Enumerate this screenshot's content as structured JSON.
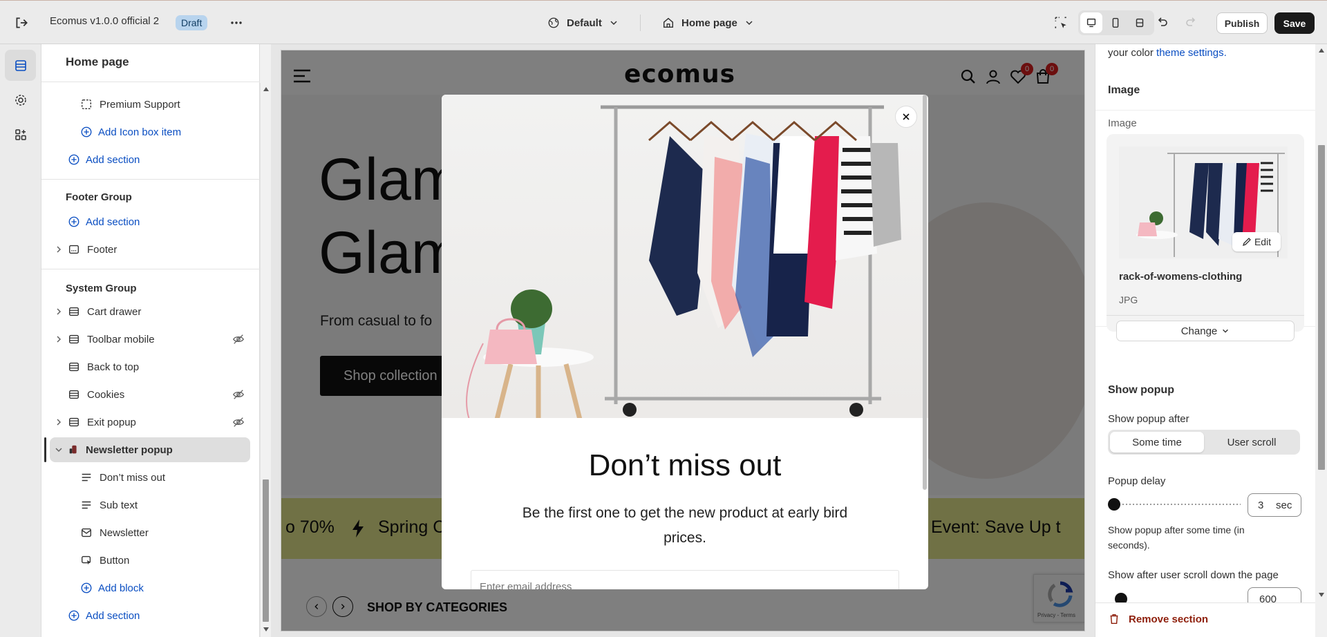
{
  "topbar": {
    "theme_name": "Ecomus v1.0.0 official 2",
    "badge": "Draft",
    "more_icon": "more-horizontal-icon",
    "context": "Default",
    "page": "Home page",
    "publish": "Publish",
    "save": "Save"
  },
  "tree": {
    "title": "Home page",
    "items": {
      "premium_support": "Premium Support",
      "add_icon_box": "Add Icon box item",
      "add_section_1": "Add section",
      "footer_group": "Footer Group",
      "add_section_2": "Add section",
      "footer": "Footer",
      "system_group": "System Group",
      "cart_drawer": "Cart drawer",
      "toolbar_mobile": "Toolbar mobile",
      "back_to_top": "Back to top",
      "cookies": "Cookies",
      "exit_popup": "Exit popup",
      "newsletter_popup": "Newsletter popup",
      "dont_miss_out": "Don’t miss out",
      "sub_text": "Sub text",
      "newsletter": "Newsletter",
      "button": "Button",
      "add_block": "Add block",
      "add_section_3": "Add section"
    }
  },
  "preview": {
    "logo": "ecomus",
    "cart_count": "0",
    "wish_count": "0",
    "hero_title_1": "Glam",
    "hero_title_2": "Glam",
    "hero_sub": "From casual to fo",
    "hero_btn": "Shop collection",
    "marquee_left": "o 70%",
    "marquee_mid": "Spring C",
    "marquee_right": "Event: Save Up t",
    "categories": "SHOP BY CATEGORIES",
    "recaptcha": "Privacy - Terms",
    "modal": {
      "heading": "Don’t miss out",
      "sub": "Be the first one to get the new product at early bird prices.",
      "email_placeholder": "Enter email address"
    }
  },
  "rightpanel": {
    "color_text": "your color",
    "color_link": "theme settings.",
    "image_heading": "Image",
    "image_label": "Image",
    "edit": "Edit",
    "file_name": "rack-of-womens-clothing",
    "file_type": "JPG",
    "change": "Change",
    "show_popup_heading": "Show popup",
    "show_popup_after": "Show popup after",
    "seg_some_time": "Some time",
    "seg_user_scroll": "User scroll",
    "popup_delay": "Popup delay",
    "delay_value": "3",
    "delay_unit": "sec",
    "delay_help": "Show popup after some time (in seconds).",
    "scroll_label": "Show after user scroll down the page",
    "scroll_value": "600",
    "remove": "Remove section"
  },
  "colors": {
    "accent_link": "#0a4ec2",
    "badge_bg": "#b8d4ee",
    "remove_red": "#8e1f0b",
    "marquee_bg": "#e0e38a"
  }
}
